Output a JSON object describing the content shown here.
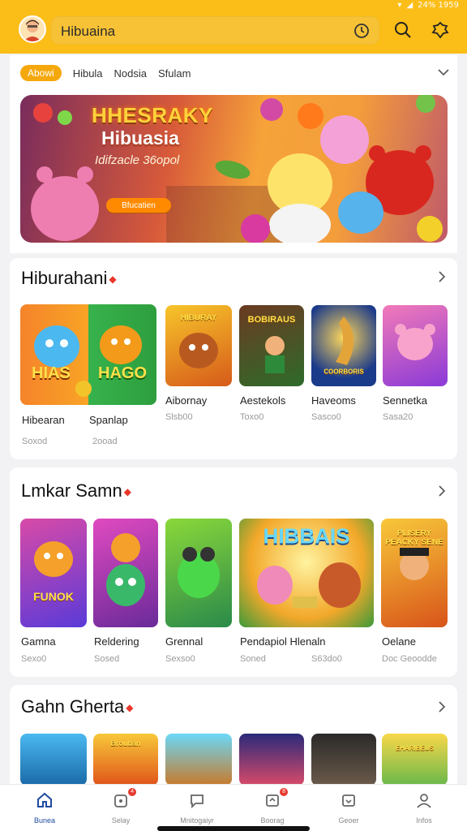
{
  "header": {
    "search_value": "Hibuaina",
    "status": "24% 1959"
  },
  "chips": {
    "items": [
      "Abowi",
      "Hibula",
      "Nodsia",
      "Sfulam"
    ]
  },
  "banner": {
    "title": "HHESRAKY",
    "subtitle": "Hibuasia",
    "line": "Idifzacle 36opol",
    "button": "Bfucatien"
  },
  "section1": {
    "title": "Hiburahani",
    "big_tile": {
      "art_left": "HIAS",
      "art_right": "HAGO",
      "name_left": "Hibearan",
      "name_right": "Spanlap",
      "sub_left": "Soxod",
      "sub_right": "2ooad"
    },
    "tiles": [
      {
        "art": "HIBURAY",
        "name": "Aibornay",
        "sub": "Slsb00"
      },
      {
        "art": "BOBIRAUS",
        "name": "Aestekols",
        "sub": "Toxo0"
      },
      {
        "art": "COORBORIS",
        "name": "Haveoms",
        "sub": "Sasco0"
      },
      {
        "art": "",
        "name": "Sennetka",
        "sub": "Sasa20"
      }
    ]
  },
  "section2": {
    "title": "Lmkar Samn",
    "tiles": [
      {
        "art": "FUNOK",
        "name": "Gamna",
        "sub": "Sexo0"
      },
      {
        "art": "",
        "name": "Reldering",
        "sub": "Sosed"
      },
      {
        "art": "",
        "name": "Grennal",
        "sub": "Sexso0"
      },
      {
        "art": "HIBBAIS",
        "name": "Pendapiol Hlenaln",
        "sub": "Soned",
        "sub2": "S63do0"
      },
      {
        "art": "PLISERY PEACKY SENE",
        "name": "Oelane",
        "sub": "Doc Geoodde"
      }
    ]
  },
  "section3": {
    "title": "Gahn Gherta",
    "tiles": [
      "",
      "Brouban",
      "",
      "",
      "",
      "EHARIBEUS"
    ]
  },
  "bottom_nav": {
    "items": [
      {
        "label": "Bunea",
        "badge": ""
      },
      {
        "label": "Selay",
        "badge": "4"
      },
      {
        "label": "Mnitogaiyr",
        "badge": ""
      },
      {
        "label": "Boorag",
        "badge": "8"
      },
      {
        "label": "Geoer",
        "badge": ""
      },
      {
        "label": "Infos",
        "badge": ""
      }
    ]
  },
  "colors": {
    "header_bg": "#fbbd17",
    "accent": "#f5a80c",
    "badge": "#e53a2e",
    "active_nav": "#1f4aa0"
  }
}
